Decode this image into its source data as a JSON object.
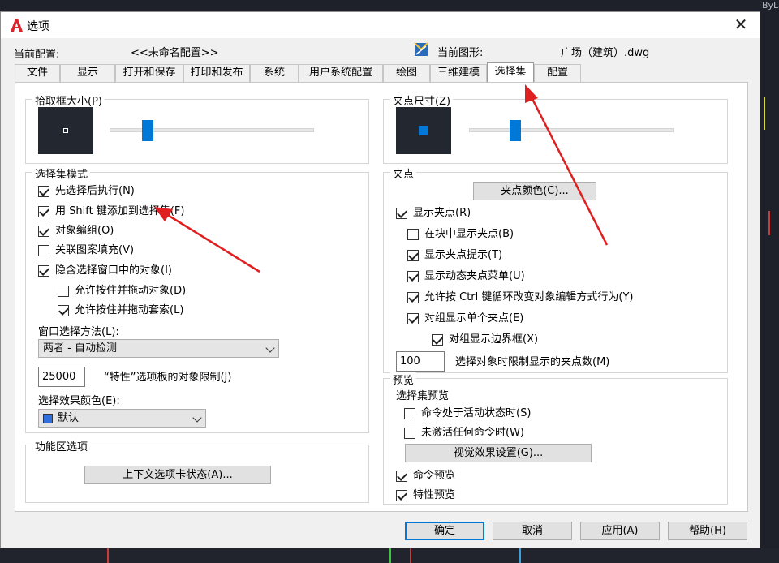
{
  "background": {
    "right_text": "ByLaye"
  },
  "dialog": {
    "title": "选项",
    "close_glyph": "✕"
  },
  "header": {
    "current_profile_label": "当前配置:",
    "current_profile_value": "<<未命名配置>>",
    "current_drawing_label": "当前图形:",
    "current_drawing_value": "广场（建筑）.dwg"
  },
  "tabs": [
    {
      "label": "文件"
    },
    {
      "label": "显示"
    },
    {
      "label": "打开和保存"
    },
    {
      "label": "打印和发布"
    },
    {
      "label": "系统"
    },
    {
      "label": "用户系统配置"
    },
    {
      "label": "绘图"
    },
    {
      "label": "三维建模"
    },
    {
      "label": "选择集",
      "active": true
    },
    {
      "label": "配置"
    }
  ],
  "pickbox": {
    "title": "拾取框大小(P)",
    "slider_level": 0.17
  },
  "gripsize": {
    "title": "夹点尺寸(Z)",
    "slider_level": 0.21
  },
  "selection_modes": {
    "title": "选择集模式",
    "items": [
      {
        "label": "先选择后执行(N)",
        "checked": true
      },
      {
        "label": "用 Shift 键添加到选择集(F)",
        "checked": true
      },
      {
        "label": "对象编组(O)",
        "checked": true
      },
      {
        "label": "关联图案填充(V)",
        "checked": false
      },
      {
        "label": "隐含选择窗口中的对象(I)",
        "checked": true
      },
      {
        "label": "允许按住并拖动对象(D)",
        "checked": false
      },
      {
        "label": "允许按住并拖动套索(L)",
        "checked": true
      }
    ],
    "window_method_label": "窗口选择方法(L):",
    "window_method_value": "两者 - 自动检测",
    "object_limit_value": "25000",
    "object_limit_label": "“特性”选项板的对象限制(J)",
    "effect_color_label": "选择效果颜色(E):",
    "effect_color_value": "默认",
    "effect_color_hex": "#2f6fe0"
  },
  "ribbon": {
    "title": "功能区选项",
    "button": "上下文选项卡状态(A)..."
  },
  "grips": {
    "title": "夹点",
    "color_button": "夹点颜色(C)...",
    "items": [
      {
        "label": "显示夹点(R)",
        "checked": true
      },
      {
        "label": "在块中显示夹点(B)",
        "checked": false
      },
      {
        "label": "显示夹点提示(T)",
        "checked": true
      },
      {
        "label": "显示动态夹点菜单(U)",
        "checked": true
      },
      {
        "label": "允许按 Ctrl 键循环改变对象编辑方式行为(Y)",
        "checked": true
      },
      {
        "label": "对组显示单个夹点(E)",
        "checked": true
      },
      {
        "label": "对组显示边界框(X)",
        "checked": true
      }
    ],
    "limit_value": "100",
    "limit_label": "选择对象时限制显示的夹点数(M)"
  },
  "preview": {
    "title": "预览",
    "subtitle": "选择集预览",
    "items": [
      {
        "label": "命令处于活动状态时(S)",
        "checked": false
      },
      {
        "label": "未激活任何命令时(W)",
        "checked": false
      }
    ],
    "visual_button": "视觉效果设置(G)...",
    "items2": [
      {
        "label": "命令预览",
        "checked": true
      },
      {
        "label": "特性预览",
        "checked": true
      }
    ]
  },
  "footer": {
    "ok": "确定",
    "cancel": "取消",
    "apply": "应用(A)",
    "help": "帮助(H)"
  },
  "colors": {
    "accent": "#0078d7",
    "annotation": "#e02020"
  }
}
